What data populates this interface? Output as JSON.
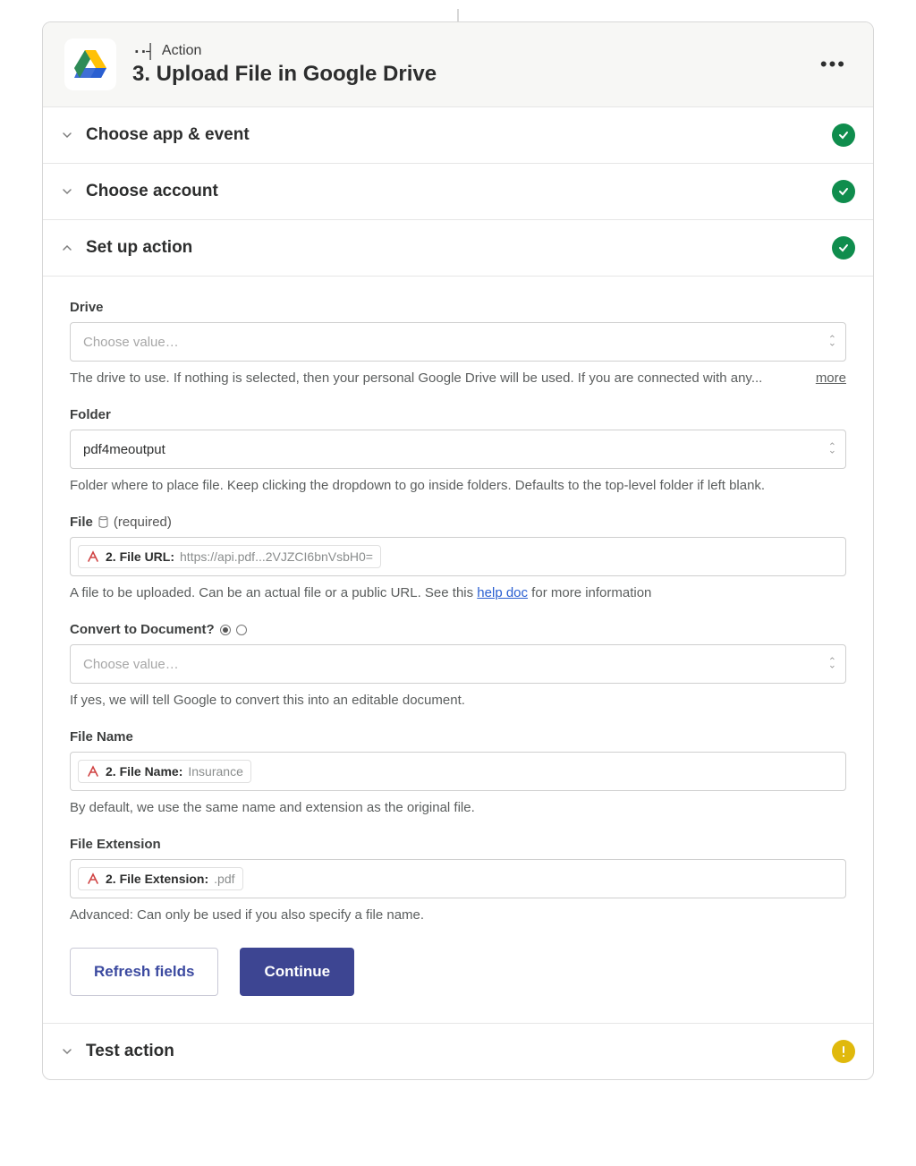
{
  "header": {
    "type_label": "Action",
    "title": "3. Upload File in Google Drive"
  },
  "sections": {
    "choose_app": {
      "title": "Choose app & event",
      "status": "ok"
    },
    "choose_account": {
      "title": "Choose account",
      "status": "ok"
    },
    "set_up_action": {
      "title": "Set up action",
      "status": "ok"
    },
    "test_action": {
      "title": "Test action",
      "status": "warn"
    }
  },
  "fields": {
    "drive": {
      "label": "Drive",
      "placeholder": "Choose value…",
      "helper": "The drive to use. If nothing is selected, then your personal Google Drive will be used. If you are connected with any...",
      "more": "more"
    },
    "folder": {
      "label": "Folder",
      "value": "pdf4meoutput",
      "helper": "Folder where to place file. Keep clicking the dropdown to go inside folders. Defaults to the top-level folder if left blank."
    },
    "file": {
      "label": "File",
      "required": "(required)",
      "pill_label": "2. File URL:",
      "pill_value": "https://api.pdf...2VJZCI6bnVsbH0=",
      "helper_before": "A file to be uploaded. Can be an actual file or a public URL. See this ",
      "helper_link": "help doc",
      "helper_after": " for more information"
    },
    "convert": {
      "label": "Convert to Document?",
      "placeholder": "Choose value…",
      "helper": "If yes, we will tell Google to convert this into an editable document."
    },
    "file_name": {
      "label": "File Name",
      "pill_label": "2. File Name:",
      "pill_value": "Insurance",
      "helper": "By default, we use the same name and extension as the original file."
    },
    "file_ext": {
      "label": "File Extension",
      "pill_label": "2. File Extension:",
      "pill_value": ".pdf",
      "helper": "Advanced: Can only be used if you also specify a file name."
    }
  },
  "buttons": {
    "refresh": "Refresh fields",
    "continue": "Continue"
  }
}
